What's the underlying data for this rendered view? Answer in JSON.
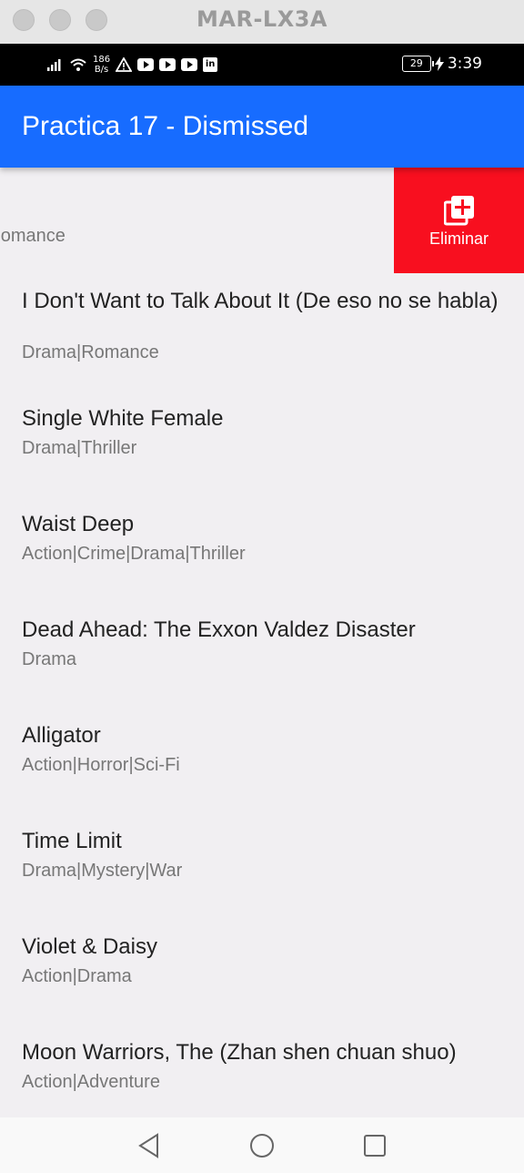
{
  "window": {
    "title": "MAR-LX3A"
  },
  "status_bar": {
    "net_speed_value": "186",
    "net_speed_unit": "B/s",
    "battery_level": "29",
    "time": "3:39"
  },
  "app_bar": {
    "title": "Practica 17 - Dismissed"
  },
  "swiped_item": {
    "genre": "a|Romance",
    "action_label": "Eliminar",
    "action_color": "#f80f1f"
  },
  "items": [
    {
      "title": "I Don't Want to Talk About It (De eso no se habla)",
      "genre": "Drama|Romance"
    },
    {
      "title": "Single White Female",
      "genre": "Drama|Thriller"
    },
    {
      "title": "Waist Deep",
      "genre": "Action|Crime|Drama|Thriller"
    },
    {
      "title": "Dead Ahead: The Exxon Valdez Disaster",
      "genre": "Drama"
    },
    {
      "title": "Alligator",
      "genre": "Action|Horror|Sci-Fi"
    },
    {
      "title": "Time Limit",
      "genre": "Drama|Mystery|War"
    },
    {
      "title": "Violet & Daisy",
      "genre": "Action|Drama"
    },
    {
      "title": "Moon Warriors, The (Zhan shen chuan shuo)",
      "genre": "Action|Adventure"
    }
  ],
  "colors": {
    "app_bar": "#176cff",
    "list_bg": "#f1eff2"
  },
  "icons": [
    "signal-icon",
    "wifi-icon",
    "warning-icon",
    "youtube-icon",
    "linkedin-icon",
    "charging-icon",
    "add-box-icon",
    "back-icon",
    "home-icon",
    "recents-icon"
  ]
}
